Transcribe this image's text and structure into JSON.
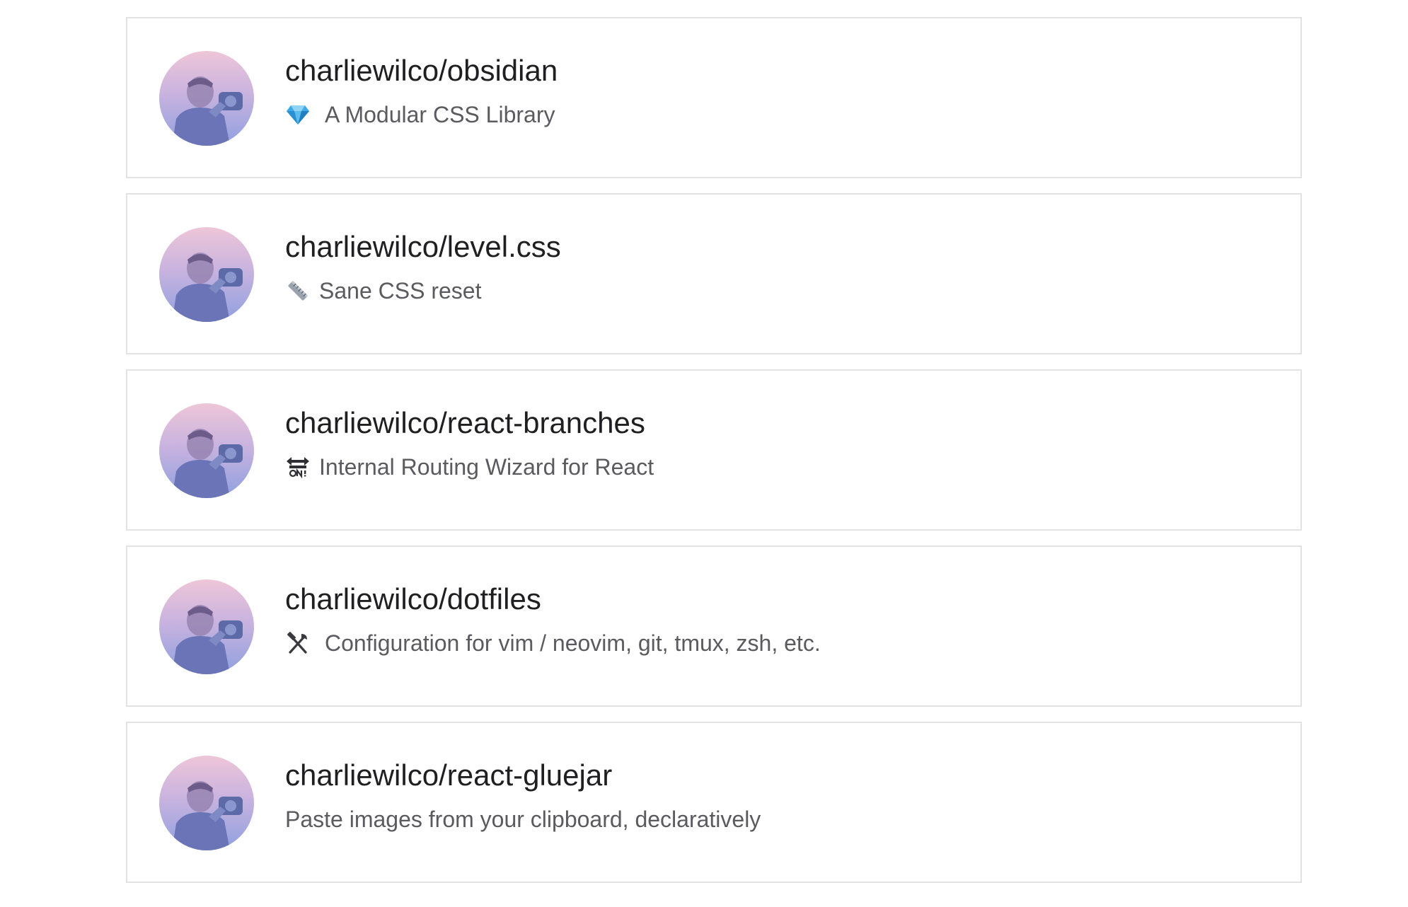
{
  "repos": [
    {
      "name": "charliewilco/obsidian",
      "icon": "gem-icon",
      "description": "A Modular CSS Library"
    },
    {
      "name": "charliewilco/level.css",
      "icon": "ruler-icon",
      "description": "Sane CSS reset"
    },
    {
      "name": "charliewilco/react-branches",
      "icon": "on-arrow-icon",
      "description": "Internal Routing Wizard for React"
    },
    {
      "name": "charliewilco/dotfiles",
      "icon": "tools-icon",
      "description": "Configuration for vim / neovim, git, tmux, zsh, etc."
    },
    {
      "name": "charliewilco/react-gluejar",
      "icon": "",
      "description": "Paste images from your clipboard, declaratively"
    }
  ],
  "colors": {
    "card_border": "#e2e2e2",
    "title_text": "#1f1f22",
    "description_text": "#5a5a5f",
    "avatar_gradient_top": "#eec6d8",
    "avatar_gradient_bottom": "#8fa0df"
  }
}
